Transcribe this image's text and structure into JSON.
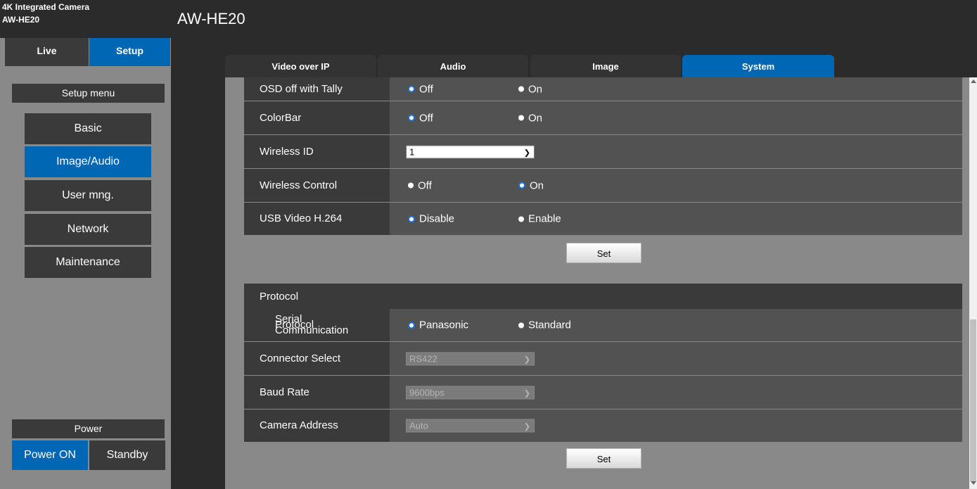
{
  "header": {
    "brand_line1": "4K Integrated Camera",
    "brand_line2": "AW-HE20",
    "model": "AW-HE20"
  },
  "mode": {
    "live": "Live",
    "setup": "Setup"
  },
  "sidebar": {
    "menu_title": "Setup menu",
    "items": [
      {
        "label": "Basic",
        "active": false
      },
      {
        "label": "Image/Audio",
        "active": true
      },
      {
        "label": "User mng.",
        "active": false
      },
      {
        "label": "Network",
        "active": false
      },
      {
        "label": "Maintenance",
        "active": false
      }
    ],
    "power_title": "Power",
    "power_on": "Power ON",
    "standby": "Standby"
  },
  "tabs": [
    "Video over IP",
    "Audio",
    "Image",
    "System"
  ],
  "active_tab": "System",
  "settings": {
    "osd_tally": {
      "label": "OSD off with Tally",
      "opt1": "Off",
      "opt2": "On",
      "selected": "Off"
    },
    "colorbar": {
      "label": "ColorBar",
      "opt1": "Off",
      "opt2": "On",
      "selected": "Off"
    },
    "wireless_id": {
      "label": "Wireless ID",
      "value": "1"
    },
    "wireless_control": {
      "label": "Wireless Control",
      "opt1": "Off",
      "opt2": "On",
      "selected": "On"
    },
    "usb_video": {
      "label": "USB Video H.264",
      "opt1": "Disable",
      "opt2": "Enable",
      "selected": "Disable"
    },
    "set_label": "Set"
  },
  "protocol": {
    "title": "Protocol",
    "serial_label_line1": "Serial Communication",
    "serial_label_line2": "Protocol",
    "serial_opt1": "Panasonic",
    "serial_opt2": "Standard",
    "serial_selected": "Panasonic",
    "connector_label": "Connector Select",
    "connector_value": "RS422",
    "baud_label": "Baud Rate",
    "baud_value": "9600bps",
    "address_label": "Camera Address",
    "address_value": "Auto",
    "set_label": "Set"
  },
  "colors": {
    "accent": "#0067b5",
    "panel": "#3a3a3a",
    "background": "#2b2b2b",
    "content": "#898989"
  }
}
